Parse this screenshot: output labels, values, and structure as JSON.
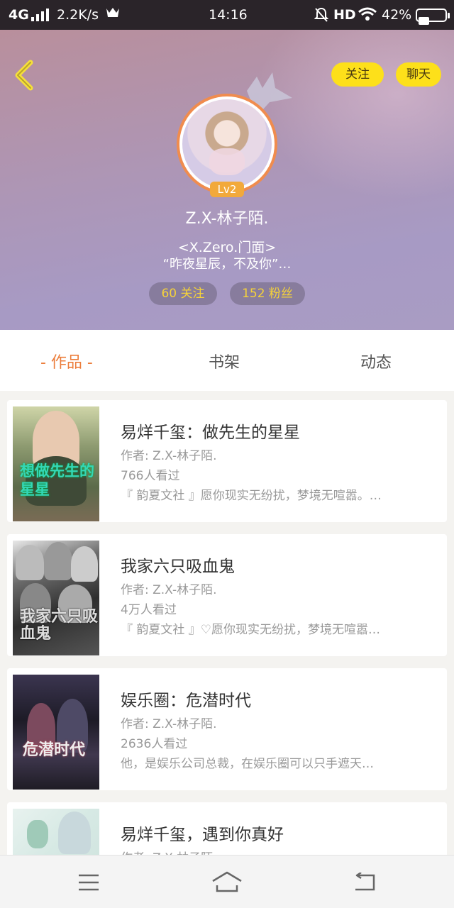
{
  "status_bar": {
    "network": "4G",
    "speed": "2.2K/s",
    "time": "14:16",
    "hd": "HD",
    "battery_text": "42%",
    "battery_level": 0.42,
    "icons": [
      "signal-icon",
      "crown-icon",
      "bell-off-icon",
      "wifi-icon",
      "battery-icon"
    ]
  },
  "header": {
    "back_icon": "chevron-left-icon",
    "follow_label": "关注",
    "chat_label": "聊天",
    "level": "Lv2",
    "name": "Z.X-林子陌.",
    "tag": "<X.Zero.门面>",
    "bio": "“昨夜星辰，不及你”…",
    "following": "60 关注",
    "fans": "152 粉丝",
    "colors": {
      "accent": "#fde01a",
      "stat_text": "#f5d23a",
      "avatar_ring": "#f08c4e"
    }
  },
  "tabs": {
    "works": "- 作品 -",
    "shelf": "书架",
    "feed": "动态",
    "active_color": "#ec7e3c"
  },
  "books": [
    {
      "title": "易烊千玺：做先生的星星",
      "author": "作者: Z.X-林子陌.",
      "views": "766人看过",
      "desc": "『 韵夏文社 』愿你现实无纷扰，梦境无喧嚣。…",
      "cover_text": "想做先生的星星"
    },
    {
      "title": "我家六只吸血鬼",
      "author": "作者: Z.X-林子陌.",
      "views": "4万人看过",
      "desc": "『 韵夏文社 』♡愿你现实无纷扰，梦境无喧嚣…",
      "cover_text": "我家六只吸血鬼"
    },
    {
      "title": "娱乐圈：危潜时代",
      "author": "作者: Z.X-林子陌.",
      "views": "2636人看过",
      "desc": "他，是娱乐公司总裁，在娱乐圈可以只手遮天…",
      "cover_text": "危潜时代"
    },
    {
      "title": "易烊千玺，遇到你真好",
      "author": "作者: Z.X-林子陌.",
      "views": "",
      "desc": "",
      "cover_text": ""
    }
  ],
  "bottom_nav": {
    "icons": [
      "menu-icon",
      "home-icon",
      "back-icon"
    ]
  }
}
